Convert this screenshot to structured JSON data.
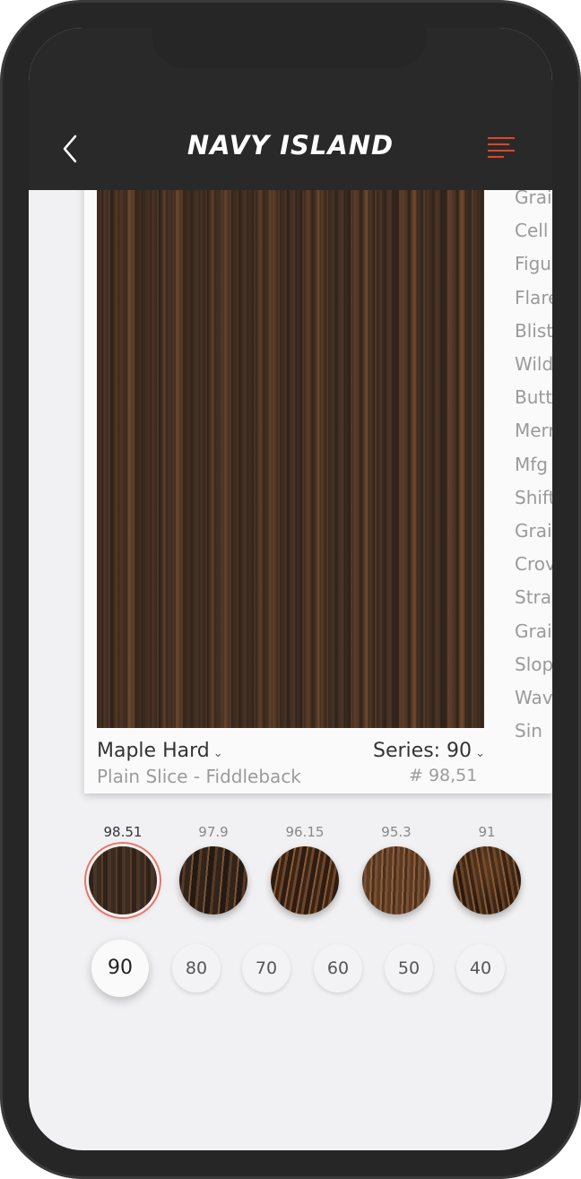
{
  "header": {
    "brand": "NAVY ISLAND",
    "back_icon": "chevron-left-icon",
    "menu_icon": "menu-icon",
    "accent_color": "#e0452b"
  },
  "species_list": [
    "Grai",
    "Cell",
    "Figu",
    "Flare",
    "Bliste",
    "Wild",
    "Butte",
    "Merr",
    "Mfg",
    "Shift",
    "Grai",
    "Crov",
    "Strai",
    "Grai",
    "Slop",
    "Wav",
    "Sin"
  ],
  "product": {
    "name": "Maple Hard",
    "cut": "Plain Slice - Fiddleback",
    "series_label": "Series: 90",
    "number": "# 98,51"
  },
  "swatches": [
    {
      "label": "98.51",
      "selected": true
    },
    {
      "label": "97.9",
      "selected": false
    },
    {
      "label": "96.15",
      "selected": false
    },
    {
      "label": "95.3",
      "selected": false
    },
    {
      "label": "91",
      "selected": false
    }
  ],
  "series_buttons": [
    {
      "label": "90",
      "selected": true
    },
    {
      "label": "80",
      "selected": false
    },
    {
      "label": "70",
      "selected": false
    },
    {
      "label": "60",
      "selected": false
    },
    {
      "label": "50",
      "selected": false
    },
    {
      "label": "40",
      "selected": false
    }
  ]
}
